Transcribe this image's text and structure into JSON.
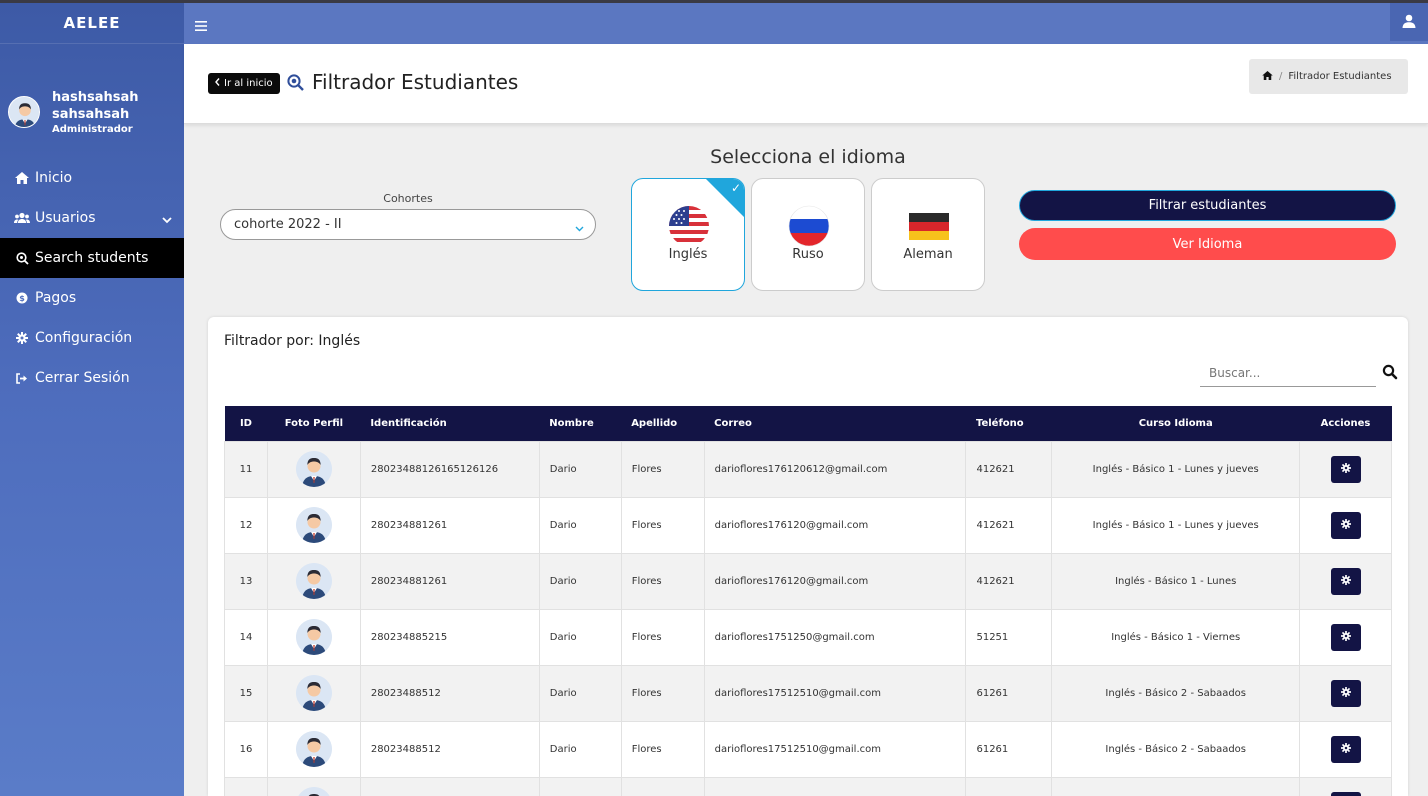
{
  "app": {
    "brand": "AELEE"
  },
  "user": {
    "name": "hashsahsah sahsahsah",
    "role": "Administrador"
  },
  "sidebar": {
    "items": [
      {
        "label": "Inicio",
        "icon": "home-icon"
      },
      {
        "label": "Usuarios",
        "icon": "users-icon"
      },
      {
        "label": "Search students",
        "icon": "search-students-icon"
      },
      {
        "label": "Pagos",
        "icon": "coin-icon"
      },
      {
        "label": "Configuración",
        "icon": "gear-icon"
      },
      {
        "label": "Cerrar Sesión",
        "icon": "sign-out-icon"
      }
    ],
    "active": "Search students"
  },
  "header": {
    "back_label": "Ir al inicio",
    "title": "Filtrador Estudiantes",
    "breadcrumb": "Filtrador Estudiantes"
  },
  "language_select": {
    "title": "Selecciona el idioma",
    "cohort_label": "Cohortes",
    "cohort_value": "cohorte 2022 - II",
    "languages": [
      {
        "name": "Inglés",
        "selected": true
      },
      {
        "name": "Ruso",
        "selected": false
      },
      {
        "name": "Aleman",
        "selected": false
      }
    ],
    "filter_button": "Filtrar estudiantes",
    "view_button": "Ver Idioma"
  },
  "table_card": {
    "title": "Filtrador por: Inglés",
    "search_placeholder": "Buscar...",
    "columns": [
      "ID",
      "Foto Perfil",
      "Identificación",
      "Nombre",
      "Apellido",
      "Correo",
      "Teléfono",
      "Curso Idioma",
      "Acciones"
    ],
    "rows": [
      {
        "id": "11",
        "identificacion": "28023488126165126126",
        "nombre": "Dario",
        "apellido": "Flores",
        "correo": "darioflores176120612@gmail.com",
        "telefono": "412621",
        "curso": "Inglés - Básico 1 - Lunes y jueves"
      },
      {
        "id": "12",
        "identificacion": "280234881261",
        "nombre": "Dario",
        "apellido": "Flores",
        "correo": "darioflores176120@gmail.com",
        "telefono": "412621",
        "curso": "Inglés - Básico 1 - Lunes y jueves"
      },
      {
        "id": "13",
        "identificacion": "280234881261",
        "nombre": "Dario",
        "apellido": "Flores",
        "correo": "darioflores176120@gmail.com",
        "telefono": "412621",
        "curso": "Inglés - Básico 1 - Lunes"
      },
      {
        "id": "14",
        "identificacion": "280234885215",
        "nombre": "Dario",
        "apellido": "Flores",
        "correo": "darioflores1751250@gmail.com",
        "telefono": "51251",
        "curso": "Inglés - Básico 1 - Viernes"
      },
      {
        "id": "15",
        "identificacion": "28023488512",
        "nombre": "Dario",
        "apellido": "Flores",
        "correo": "darioflores17512510@gmail.com",
        "telefono": "61261",
        "curso": "Inglés - Básico 2 - Sabaados"
      },
      {
        "id": "16",
        "identificacion": "28023488512",
        "nombre": "Dario",
        "apellido": "Flores",
        "correo": "darioflores17512510@gmail.com",
        "telefono": "61261",
        "curso": "Inglés - Básico 2 - Sabaados"
      },
      {
        "id": "",
        "identificacion": "",
        "nombre": "",
        "apellido": "",
        "correo": "",
        "telefono": "",
        "curso": ""
      }
    ]
  },
  "colors": {
    "sidebar": "#4e6dbd",
    "topbar": "#5b77c1",
    "navy": "#131445",
    "accent": "#20a6dc",
    "danger": "#ff4c4c"
  }
}
